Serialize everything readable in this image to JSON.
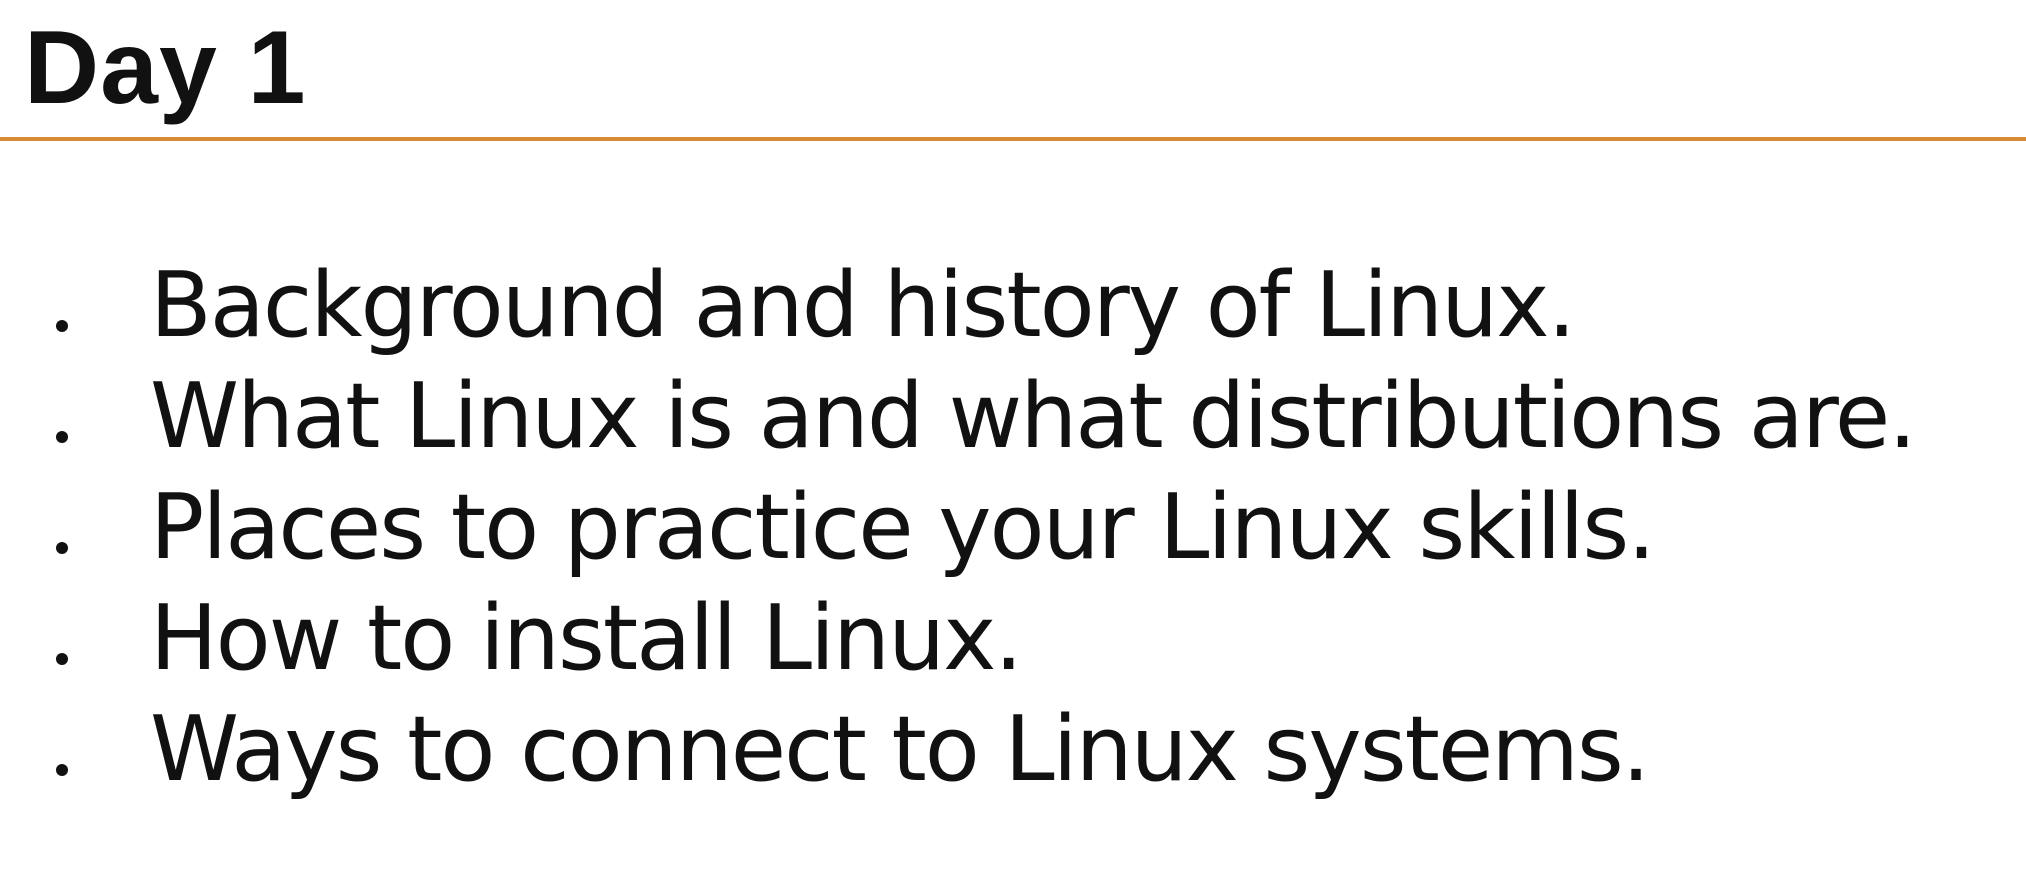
{
  "slide": {
    "title": "Day 1",
    "accent_color": "#d88a35",
    "bullets": [
      {
        "text": "Background and history of Linux."
      },
      {
        "text": "What Linux is and what distributions are."
      },
      {
        "text": "Places to practice your Linux skills."
      },
      {
        "text": "How to install Linux."
      },
      {
        "text": "Ways to connect to Linux systems."
      }
    ]
  }
}
